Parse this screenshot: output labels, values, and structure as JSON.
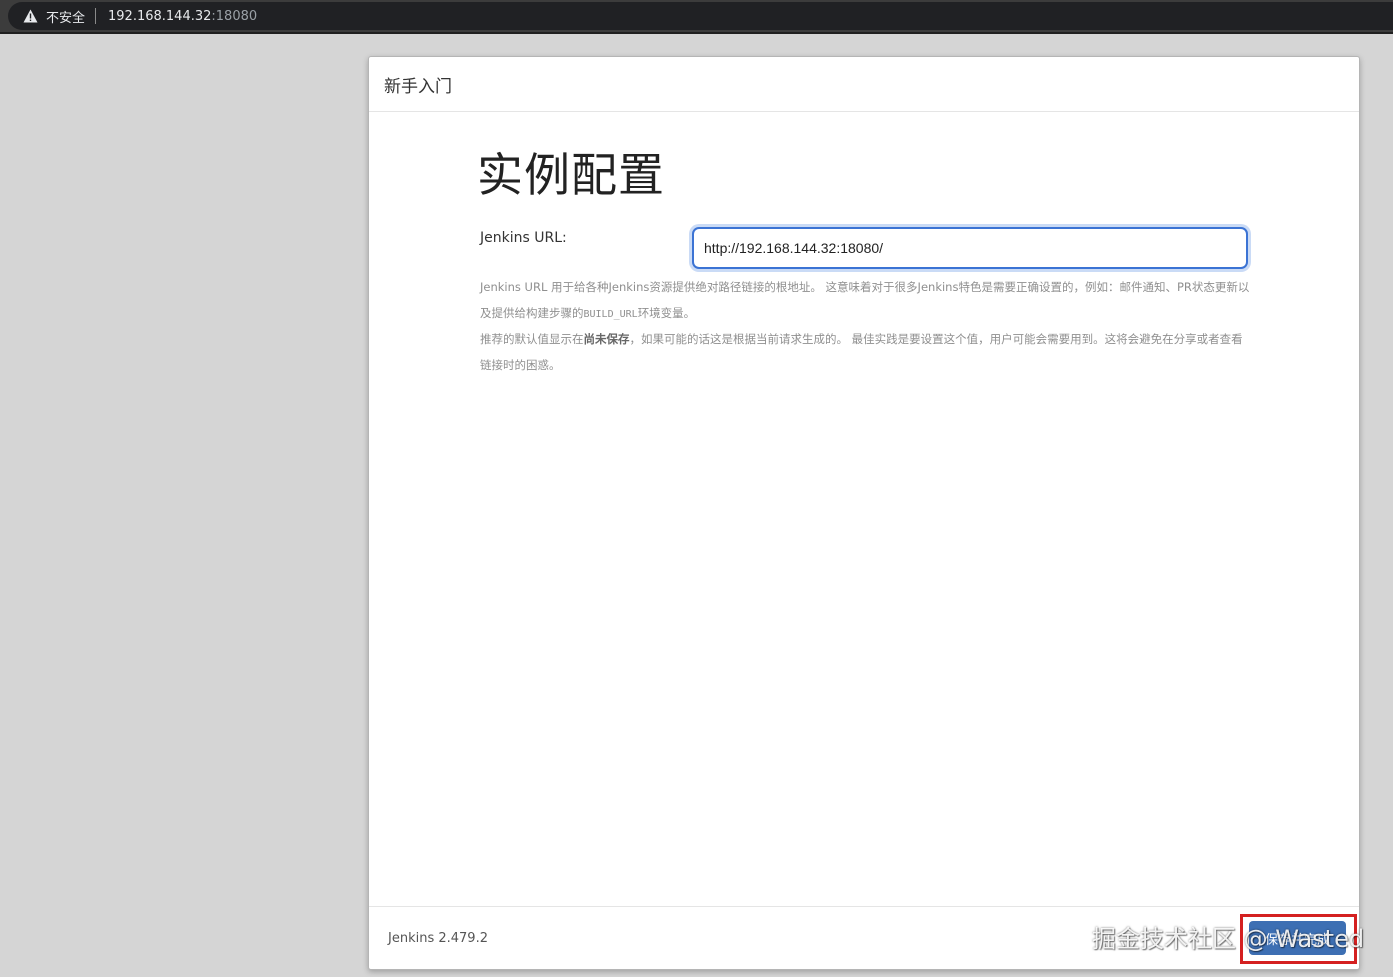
{
  "browser": {
    "security_label": "不安全",
    "url_host": "192.168.144.32",
    "url_port": ":18080",
    "warning_icon": "warning-triangle-icon"
  },
  "dialog": {
    "header_title": "新手入门",
    "page_title": "实例配置",
    "url_label": "Jenkins URL:",
    "url_value": "http://192.168.144.32:18080/",
    "help": {
      "line1_a": "Jenkins URL 用于给各种Jenkins资源提供绝对路径链接的根地址。 这意味着对于很多Jenkins特色是需要正确设置的，例如：邮件通知、PR状态更新以及提供给构建步骤的",
      "line1_code": "BUILD_URL",
      "line1_b": "环境变量。",
      "line2_a": "推荐的默认值显示在",
      "line2_strong": "尚未保存",
      "line2_b": "，如果可能的话这是根据当前请求生成的。 最佳实践是要设置这个值，用户可能会需要用到。这将会避免在分享或者查看链接时的困惑。"
    },
    "footer": {
      "version": "Jenkins 2.479.2",
      "save_label": "保存并完成"
    }
  },
  "watermark": "掘金技术社区 @ Wasted",
  "colors": {
    "primary_button": "#3d6fb3",
    "highlight": "#d42020",
    "focus_border": "#3b73d4"
  }
}
